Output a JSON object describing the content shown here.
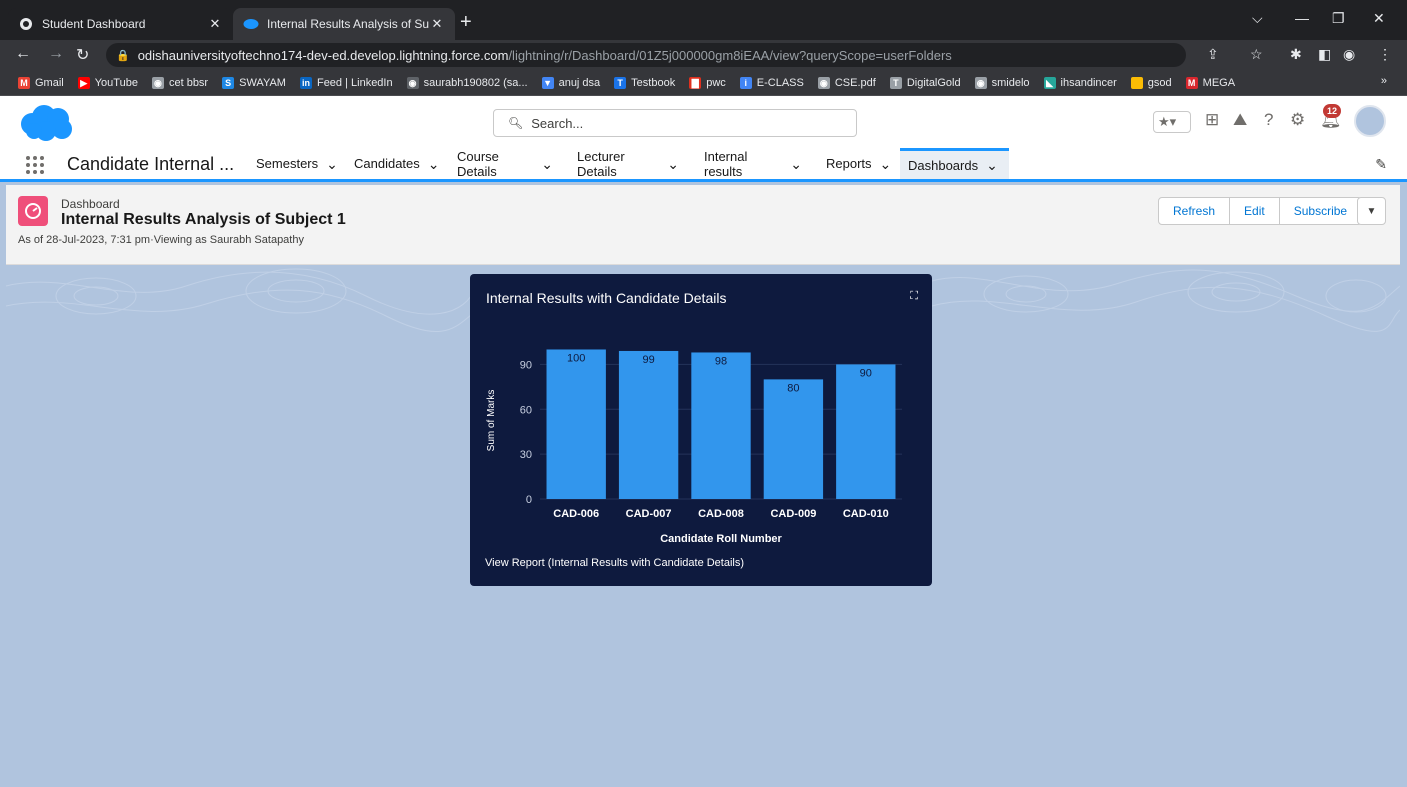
{
  "browser": {
    "tabs": [
      {
        "label": "Student Dashboard",
        "active": false
      },
      {
        "label": "Internal Results Analysis of Subje",
        "active": true
      }
    ],
    "url_host": "odishauniversityoftechno174-dev-ed.develop.lightning.force.com",
    "url_path": "/lightning/r/Dashboard/01Z5j000000gm8iEAA/view?queryScope=userFolders",
    "bookmarks": [
      {
        "label": "Gmail",
        "color": "#ea4335",
        "glyph": "M"
      },
      {
        "label": "YouTube",
        "color": "#ff0000",
        "glyph": "▶"
      },
      {
        "label": "cet bbsr",
        "color": "#9aa0a6",
        "glyph": "◉"
      },
      {
        "label": "SWAYAM",
        "color": "#1e88e5",
        "glyph": "S"
      },
      {
        "label": "Feed | LinkedIn",
        "color": "#0a66c2",
        "glyph": "in"
      },
      {
        "label": "saurabh190802 (sa...",
        "color": "#5f6368",
        "glyph": "◉"
      },
      {
        "label": "anuj dsa",
        "color": "#4285f4",
        "glyph": "▼"
      },
      {
        "label": "Testbook",
        "color": "#1a73e8",
        "glyph": "T"
      },
      {
        "label": "pwc",
        "color": "#e0301e",
        "glyph": "▇"
      },
      {
        "label": "E-CLASS",
        "color": "#4285f4",
        "glyph": "i"
      },
      {
        "label": "CSE.pdf",
        "color": "#9aa0a6",
        "glyph": "◉"
      },
      {
        "label": "DigitalGold",
        "color": "#9aa0a6",
        "glyph": "T"
      },
      {
        "label": "smidelo",
        "color": "#9aa0a6",
        "glyph": "◉"
      },
      {
        "label": "ihsandincer",
        "color": "#26a69a",
        "glyph": "◣"
      },
      {
        "label": "gsod",
        "color": "#fbbc04",
        "glyph": " "
      },
      {
        "label": "MEGA",
        "color": "#d9272e",
        "glyph": "M"
      }
    ],
    "bookmarks_more": "»"
  },
  "sf": {
    "search_placeholder": "Search...",
    "notification_count": "12",
    "app_name": "Candidate Internal ...",
    "nav_items": [
      {
        "label": "Semesters",
        "active": false
      },
      {
        "label": "Candidates",
        "active": false
      },
      {
        "label": "Course Details",
        "active": false
      },
      {
        "label": "Lecturer Details",
        "active": false
      },
      {
        "label": "Internal results",
        "active": false
      },
      {
        "label": "Reports",
        "active": false
      },
      {
        "label": "Dashboards",
        "active": true
      }
    ]
  },
  "page": {
    "crumb": "Dashboard",
    "title": "Internal Results Analysis of Subject 1",
    "as_of": "As of 28-Jul-2023, 7:31 pm·Viewing as Saurabh Satapathy",
    "buttons": {
      "refresh": "Refresh",
      "edit": "Edit",
      "subscribe": "Subscribe"
    }
  },
  "card": {
    "title": "Internal Results with Candidate Details",
    "view_report": "View Report (Internal Results with Candidate Details)"
  },
  "chart_data": {
    "type": "bar",
    "categories": [
      "CAD-006",
      "CAD-007",
      "CAD-008",
      "CAD-009",
      "CAD-010"
    ],
    "values": [
      100,
      99,
      98,
      80,
      90
    ],
    "xlabel": "Candidate Roll Number",
    "ylabel": "Sum of Marks",
    "ylim": [
      0,
      105
    ],
    "yticks": [
      0,
      30,
      60,
      90
    ],
    "bar_color": "#3296ed",
    "grid": true
  }
}
